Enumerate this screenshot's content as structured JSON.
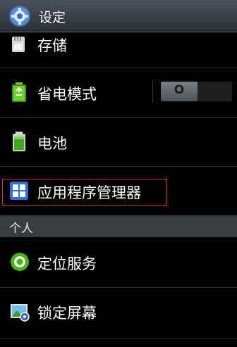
{
  "titlebar": {
    "title": "设定",
    "icon": "settings-gear-icon"
  },
  "items": [
    {
      "label": "存储",
      "icon": "storage-card-icon"
    },
    {
      "label": "省电模式",
      "icon": "power-saving-battery-icon",
      "toggle": {
        "state_label": "O",
        "on": false
      }
    },
    {
      "label": "电池",
      "icon": "battery-icon"
    },
    {
      "label": "应用程序管理器",
      "icon": "app-grid-icon"
    }
  ],
  "section": {
    "label": "个人"
  },
  "personal_items": [
    {
      "label": "定位服务",
      "icon": "location-target-icon"
    },
    {
      "label": "锁定屏幕",
      "icon": "lock-screen-picture-icon"
    }
  ],
  "colors": {
    "highlight_border": "#c8323a",
    "accent_green": "#4caf1e",
    "accent_blue": "#2f6fd8"
  }
}
